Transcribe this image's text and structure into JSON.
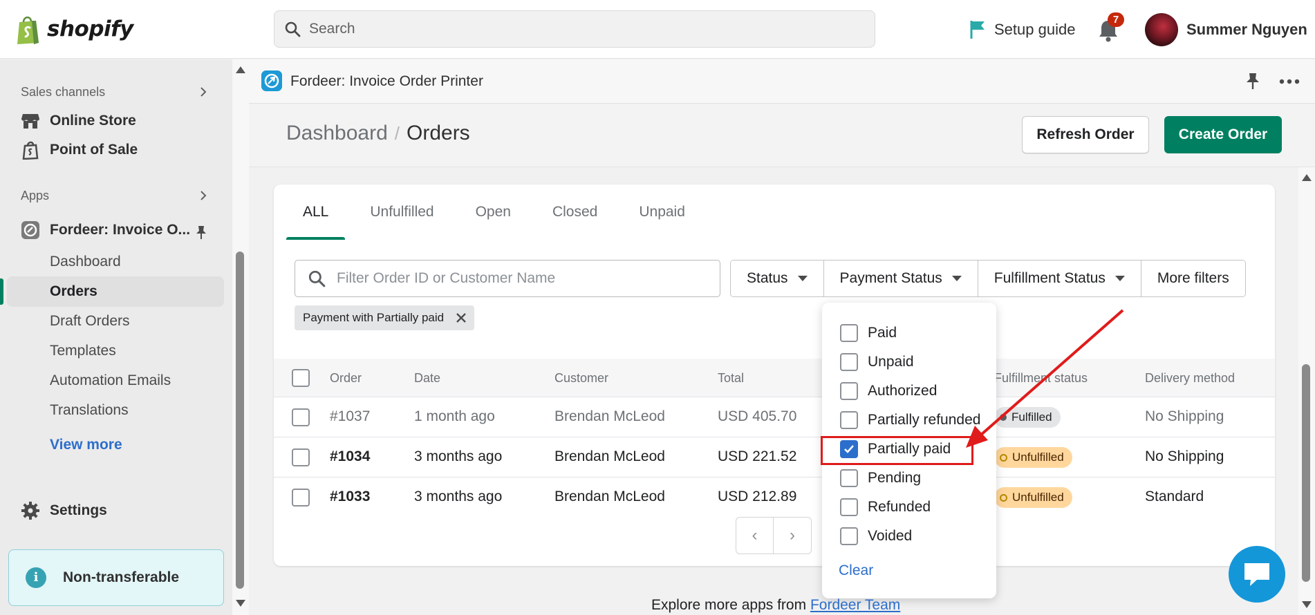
{
  "topbar": {
    "brand": "shopify",
    "search_placeholder": "Search",
    "setup_label": "Setup guide",
    "notification_count": "7",
    "user_name": "Summer Nguyen"
  },
  "sidebar": {
    "sales_channels_label": "Sales channels",
    "channels": [
      {
        "label": "Online Store"
      },
      {
        "label": "Point of Sale"
      }
    ],
    "apps_label": "Apps",
    "app_name": "Fordeer: Invoice O...",
    "app_items": [
      {
        "label": "Dashboard"
      },
      {
        "label": "Orders"
      },
      {
        "label": "Draft Orders"
      },
      {
        "label": "Templates"
      },
      {
        "label": "Automation Emails"
      },
      {
        "label": "Translations"
      }
    ],
    "view_more": "View more",
    "settings": "Settings",
    "notice": "Non-transferable"
  },
  "app_header": {
    "title": "Fordeer: Invoice Order Printer"
  },
  "page": {
    "breadcrumb_parent": "Dashboard",
    "breadcrumb_sep": "/",
    "breadcrumb_current": "Orders",
    "refresh_label": "Refresh Order",
    "create_label": "Create Order"
  },
  "tabs": [
    {
      "label": "ALL",
      "active": true
    },
    {
      "label": "Unfulfilled"
    },
    {
      "label": "Open"
    },
    {
      "label": "Closed"
    },
    {
      "label": "Unpaid"
    }
  ],
  "filters": {
    "placeholder": "Filter Order ID or Customer Name",
    "buttons": [
      "Status",
      "Payment Status",
      "Fulfillment Status",
      "More filters"
    ],
    "applied_tag": "Payment with Partially paid"
  },
  "table": {
    "headers": {
      "order": "Order",
      "date": "Date",
      "customer": "Customer",
      "total": "Total",
      "fulfillment": "Fulfillment status",
      "delivery": "Delivery method"
    },
    "rows": [
      {
        "order": "#1037",
        "date": "1 month ago",
        "customer": "Brendan McLeod",
        "total": "USD 405.70",
        "fulfillment": "Fulfilled",
        "delivery": "No Shipping"
      },
      {
        "order": "#1034",
        "date": "3 months ago",
        "customer": "Brendan McLeod",
        "total": "USD 221.52",
        "fulfillment": "Unfulfilled",
        "delivery": "No Shipping"
      },
      {
        "order": "#1033",
        "date": "3 months ago",
        "customer": "Brendan McLeod",
        "total": "USD 212.89",
        "fulfillment": "Unfulfilled",
        "delivery": "Standard"
      }
    ]
  },
  "pager": {
    "prev": "‹",
    "next": "›"
  },
  "dropdown": {
    "options": [
      {
        "label": "Paid",
        "checked": false
      },
      {
        "label": "Unpaid",
        "checked": false
      },
      {
        "label": "Authorized",
        "checked": false
      },
      {
        "label": "Partially refunded",
        "checked": false
      },
      {
        "label": "Partially paid",
        "checked": true
      },
      {
        "label": "Pending",
        "checked": false
      },
      {
        "label": "Refunded",
        "checked": false
      },
      {
        "label": "Voided",
        "checked": false
      }
    ],
    "clear_label": "Clear"
  },
  "footer": {
    "text": "Explore more apps from",
    "link": "Fordeer Team"
  },
  "colors": {
    "accent_green": "#008060",
    "link_blue": "#2c6ecb",
    "annotation_red": "#e01b1b"
  }
}
